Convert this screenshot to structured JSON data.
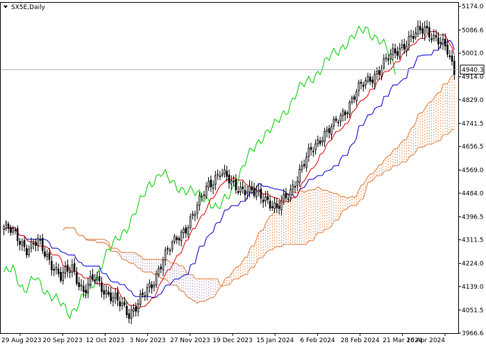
{
  "chart_data": {
    "type": "candlestick",
    "symbol_label": "SX5E,Daily",
    "last_price_label": "4940.3",
    "last_price": 4940.3,
    "ylim": [
      3966.6,
      5190
    ],
    "y_ticks": [
      "5174.0",
      "5086.6",
      "5001.0",
      "4914.0",
      "4829.0",
      "4741.5",
      "4656.5",
      "4569.0",
      "4484.0",
      "4396.5",
      "4311.5",
      "4224.0",
      "4139.0",
      "4051.5",
      "3966.6"
    ],
    "x_ticks": [
      "29 Aug 2023",
      "20 Sep 2023",
      "12 Oct 2023",
      "3 Nov 2023",
      "27 Nov 2023",
      "19 Dec 2023",
      "15 Jan 2024",
      "6 Feb 2024",
      "28 Feb 2024",
      "21 Mar 2024",
      "16 Apr 2024"
    ],
    "grid": false,
    "colors": {
      "tenkan": "#dd0000",
      "kijun": "#0000cc",
      "chikou": "#00cc00",
      "cloud_bull": "#e08040",
      "cloud_bear": "#b090c8",
      "candle": "#000000",
      "price_line": "#b0b0b0"
    },
    "close_anchors": [
      [
        0,
        4360
      ],
      [
        5,
        4330
      ],
      [
        10,
        4280
      ],
      [
        15,
        4300
      ],
      [
        20,
        4240
      ],
      [
        25,
        4170
      ],
      [
        30,
        4210
      ],
      [
        35,
        4120
      ],
      [
        40,
        4170
      ],
      [
        45,
        4120
      ],
      [
        50,
        4080
      ],
      [
        55,
        4040
      ],
      [
        60,
        4090
      ],
      [
        65,
        4140
      ],
      [
        70,
        4250
      ],
      [
        75,
        4300
      ],
      [
        80,
        4360
      ],
      [
        85,
        4430
      ],
      [
        90,
        4520
      ],
      [
        95,
        4560
      ],
      [
        100,
        4520
      ],
      [
        105,
        4500
      ],
      [
        110,
        4480
      ],
      [
        115,
        4470
      ],
      [
        120,
        4420
      ],
      [
        125,
        4480
      ],
      [
        130,
        4560
      ],
      [
        135,
        4640
      ],
      [
        140,
        4700
      ],
      [
        145,
        4730
      ],
      [
        150,
        4790
      ],
      [
        155,
        4860
      ],
      [
        160,
        4900
      ],
      [
        165,
        4940
      ],
      [
        170,
        4990
      ],
      [
        175,
        5030
      ],
      [
        180,
        5060
      ],
      [
        185,
        5100
      ],
      [
        190,
        5050
      ],
      [
        195,
        5010
      ],
      [
        198,
        4940
      ]
    ]
  }
}
